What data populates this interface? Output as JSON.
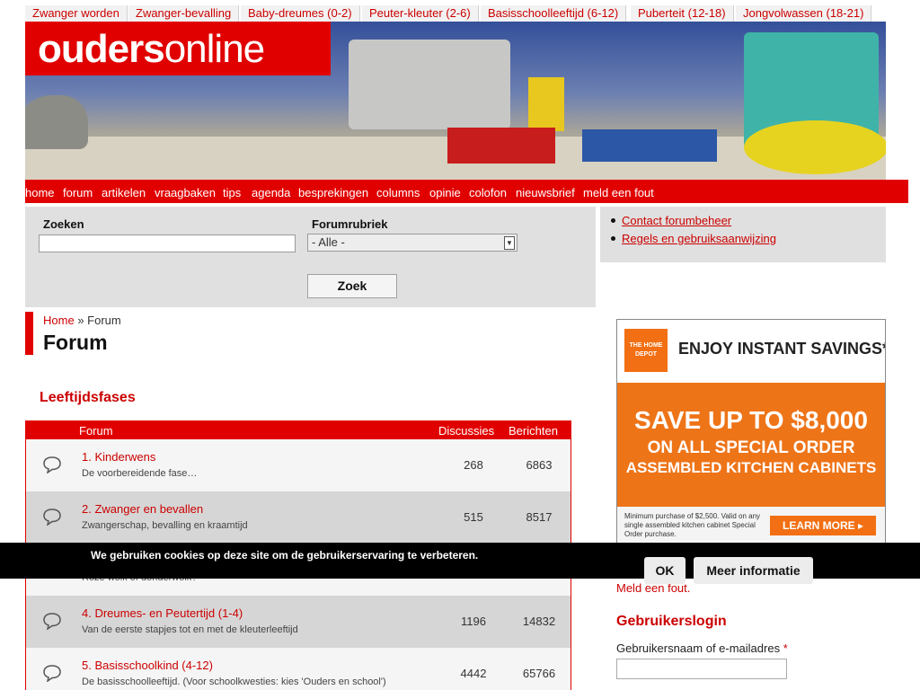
{
  "age_nav": [
    "Zwanger worden",
    "Zwanger-bevalling",
    "Baby-dreumes (0-2)",
    "Peuter-kleuter (2-6)",
    "Basisschoolleeftijd (6-12)",
    "Puberteit (12-18)",
    "Jongvolwassen (18-21)"
  ],
  "logo": {
    "bold": "ouders",
    "light": "online"
  },
  "main_nav": [
    "home",
    "forum",
    "artikelen",
    "vraagbaken",
    "tips",
    "agenda",
    "besprekingen",
    "columns",
    "opinie",
    "colofon",
    "nieuwsbrief",
    "meld een fout"
  ],
  "search": {
    "label": "Zoeken",
    "value": "",
    "rubric_label": "Forumrubriek",
    "rubric_value": "- Alle -",
    "button": "Zoek"
  },
  "links": [
    "Contact forumbeheer",
    "Regels en gebruiksaanwijzing"
  ],
  "breadcrumb": {
    "home": "Home",
    "separator": "»",
    "current": "Forum"
  },
  "page_title": "Forum",
  "section_title": "Leeftijdsfases",
  "table": {
    "headers": {
      "forum": "Forum",
      "discussions": "Discussies",
      "posts": "Berichten"
    },
    "rows": [
      {
        "name": "1. Kinderwens",
        "desc": "De voorbereidende fase…",
        "discussions": "268",
        "posts": "6863"
      },
      {
        "name": "2. Zwanger en bevallen",
        "desc": "Zwangerschap, bevalling en kraamtijd",
        "discussions": "515",
        "posts": "8517"
      },
      {
        "name": "",
        "desc": "Roze wolk of donderwolk?",
        "discussions": "",
        "posts": ""
      },
      {
        "name": "4. Dreumes- en Peutertijd (1-4)",
        "desc": "Van de eerste stapjes tot en met de kleuterleeftijd",
        "discussions": "1196",
        "posts": "14832"
      },
      {
        "name": "5. Basisschoolkind (4-12)",
        "desc": "De basisschoolleeftijd. (Voor schoolkwesties: kies 'Ouders en school')",
        "discussions": "4442",
        "posts": "65766"
      }
    ]
  },
  "ad": {
    "logo_text": "THE HOME DEPOT",
    "headline": "ENJOY INSTANT SAVINGS*",
    "big1": "SAVE UP TO $8,000",
    "big2": "ON ALL SPECIAL ORDER",
    "big3": "ASSEMBLED KITCHEN CABINETS",
    "fine": "Minimum purchase of $2,500. Valid on any single assembled kitchen cabinet Special Order purchase.",
    "cta": "LEARN MORE ▸"
  },
  "report_link": "Meld een fout.",
  "login": {
    "title": "Gebruikerslogin",
    "label": "Gebruikersnaam of e-mailadres",
    "required": "*"
  },
  "cookie": {
    "text": "We gebruiken cookies op deze site om de gebruikerservaring te verbeteren.",
    "ok": "OK",
    "more": "Meer informatie"
  },
  "colors": {
    "brand_red": "#e10000",
    "link_red": "#cc0000",
    "grey_panel": "#e0e0e0",
    "ad_orange": "#ee7418"
  }
}
